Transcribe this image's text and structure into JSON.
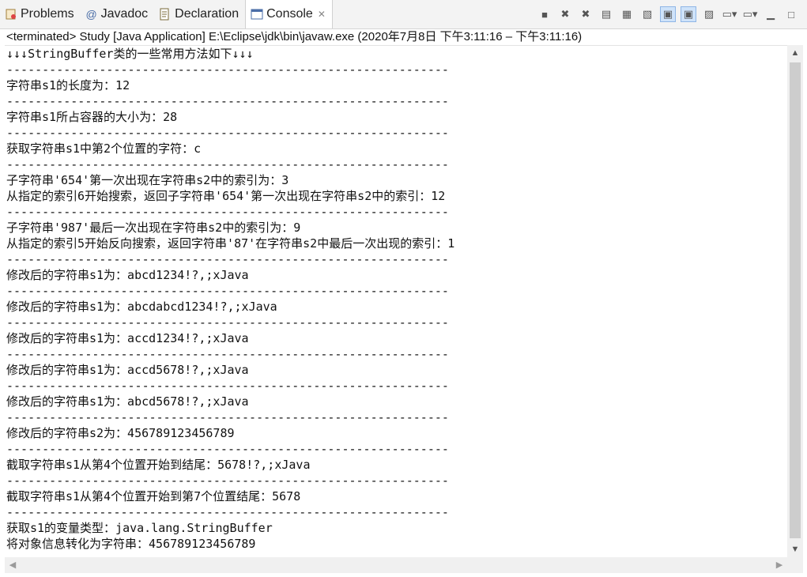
{
  "tabs": [
    {
      "label": "Problems",
      "icon": "problems-icon"
    },
    {
      "label": "Javadoc",
      "icon": "javadoc-icon"
    },
    {
      "label": "Declaration",
      "icon": "declaration-icon"
    },
    {
      "label": "Console",
      "icon": "console-icon",
      "active": true
    }
  ],
  "toolbar": {
    "buttons": [
      "terminate-icon",
      "remove-launch-icon",
      "remove-all-icon",
      "clear-console-icon",
      "scroll-lock-icon",
      "word-wrap-icon",
      "show-console-on-output-icon",
      "show-console-on-error-icon",
      "pin-console-icon",
      "display-selected-console-icon",
      "open-console-icon",
      "minimize-icon",
      "maximize-icon"
    ]
  },
  "status": "<terminated> Study [Java Application] E:\\Eclipse\\jdk\\bin\\javaw.exe  (2020年7月8日 下午3:11:16 – 下午3:11:16)",
  "console": {
    "lines": [
      "↓↓↓StringBuffer类的一些常用方法如下↓↓↓",
      "--------------------------------------------------------------",
      "字符串s1的长度为：12",
      "--------------------------------------------------------------",
      "字符串s1所占容器的大小为：28",
      "--------------------------------------------------------------",
      "获取字符串s1中第2个位置的字符：c",
      "--------------------------------------------------------------",
      "子字符串'654'第一次出现在字符串s2中的索引为：3",
      "从指定的索引6开始搜索，返回子字符串'654'第一次出现在字符串s2中的索引：12",
      "--------------------------------------------------------------",
      "子字符串'987'最后一次出现在字符串s2中的索引为：9",
      "从指定的索引5开始反向搜索，返回字符串'87'在字符串s2中最后一次出现的索引：1",
      "--------------------------------------------------------------",
      "修改后的字符串s1为：abcd1234!?,;xJava",
      "--------------------------------------------------------------",
      "修改后的字符串s1为：abcdabcd1234!?,;xJava",
      "--------------------------------------------------------------",
      "修改后的字符串s1为：accd1234!?,;xJava",
      "--------------------------------------------------------------",
      "修改后的字符串s1为：accd5678!?,;xJava",
      "--------------------------------------------------------------",
      "修改后的字符串s1为：abcd5678!?,;xJava",
      "--------------------------------------------------------------",
      "修改后的字符串s2为：456789123456789",
      "--------------------------------------------------------------",
      "截取字符串s1从第4个位置开始到结尾：5678!?,;xJava",
      "--------------------------------------------------------------",
      "截取字符串s1从第4个位置开始到第7个位置结尾：5678",
      "--------------------------------------------------------------",
      "获取s1的变量类型：java.lang.StringBuffer",
      "将对象信息转化为字符串：456789123456789"
    ]
  }
}
